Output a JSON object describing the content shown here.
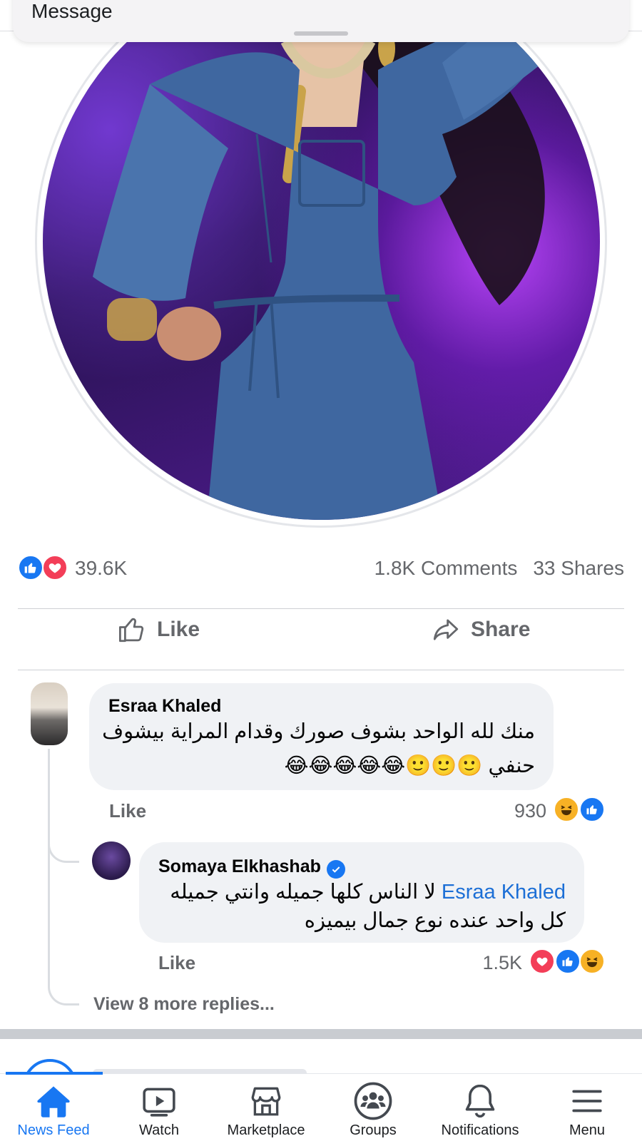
{
  "message_sheet": {
    "title": "Message"
  },
  "post": {
    "reaction_count": "39.6K",
    "comments": "1.8K Comments",
    "shares": "33 Shares",
    "actions": {
      "like": "Like",
      "share": "Share"
    }
  },
  "comments": [
    {
      "author": "Esraa Khaled",
      "line1": "منك لله الواحد بشوف صورك وقدام المراية بيشوف",
      "line2": "حنفي 🙂🙂🙂😂😂😂😂😂",
      "like_label": "Like",
      "reaction_count": "930"
    },
    {
      "author": "Somaya Elkhashab",
      "verified": true,
      "mention": "Esraa Khaled",
      "line1": "لا الناس كلها جميله وانتي جميله",
      "line2": "كل واحد عنده نوع جمال بيميزه",
      "like_label": "Like",
      "reaction_count": "1.5K"
    }
  ],
  "view_more_replies": "View 8 more replies...",
  "bottom_nav": {
    "items": [
      {
        "label": "News Feed",
        "icon": "home-icon",
        "active": true
      },
      {
        "label": "Watch",
        "icon": "watch-icon"
      },
      {
        "label": "Marketplace",
        "icon": "marketplace-icon"
      },
      {
        "label": "Groups",
        "icon": "groups-icon"
      },
      {
        "label": "Notifications",
        "icon": "bell-icon"
      },
      {
        "label": "Menu",
        "icon": "menu-icon"
      }
    ]
  },
  "colors": {
    "accent": "#1877f2",
    "love": "#f33e58",
    "muted_text": "#65676b",
    "bubble": "#f0f2f5"
  }
}
